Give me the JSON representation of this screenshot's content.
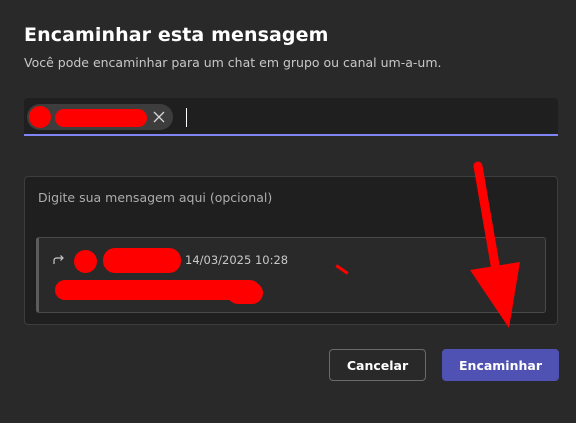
{
  "dialog": {
    "title": "Encaminhar esta mensagem",
    "subtitle": "Você pode encaminhar para um chat em grupo ou canal um-a-um."
  },
  "recipient": {
    "chip_icons": {
      "remove": "close-icon"
    }
  },
  "message": {
    "placeholder": "Digite sua mensagem aqui (opcional)",
    "quoted": {
      "timestamp": "14/03/2025 10:28",
      "icon": "forward-icon"
    }
  },
  "actions": {
    "cancel_label": "Cancelar",
    "forward_label": "Encaminhar"
  },
  "colors": {
    "background": "#292929",
    "field_background": "#1f1f1f",
    "accent": "#4f52b2",
    "focus_underline": "#7f85f5",
    "annotation": "#ff0000"
  }
}
